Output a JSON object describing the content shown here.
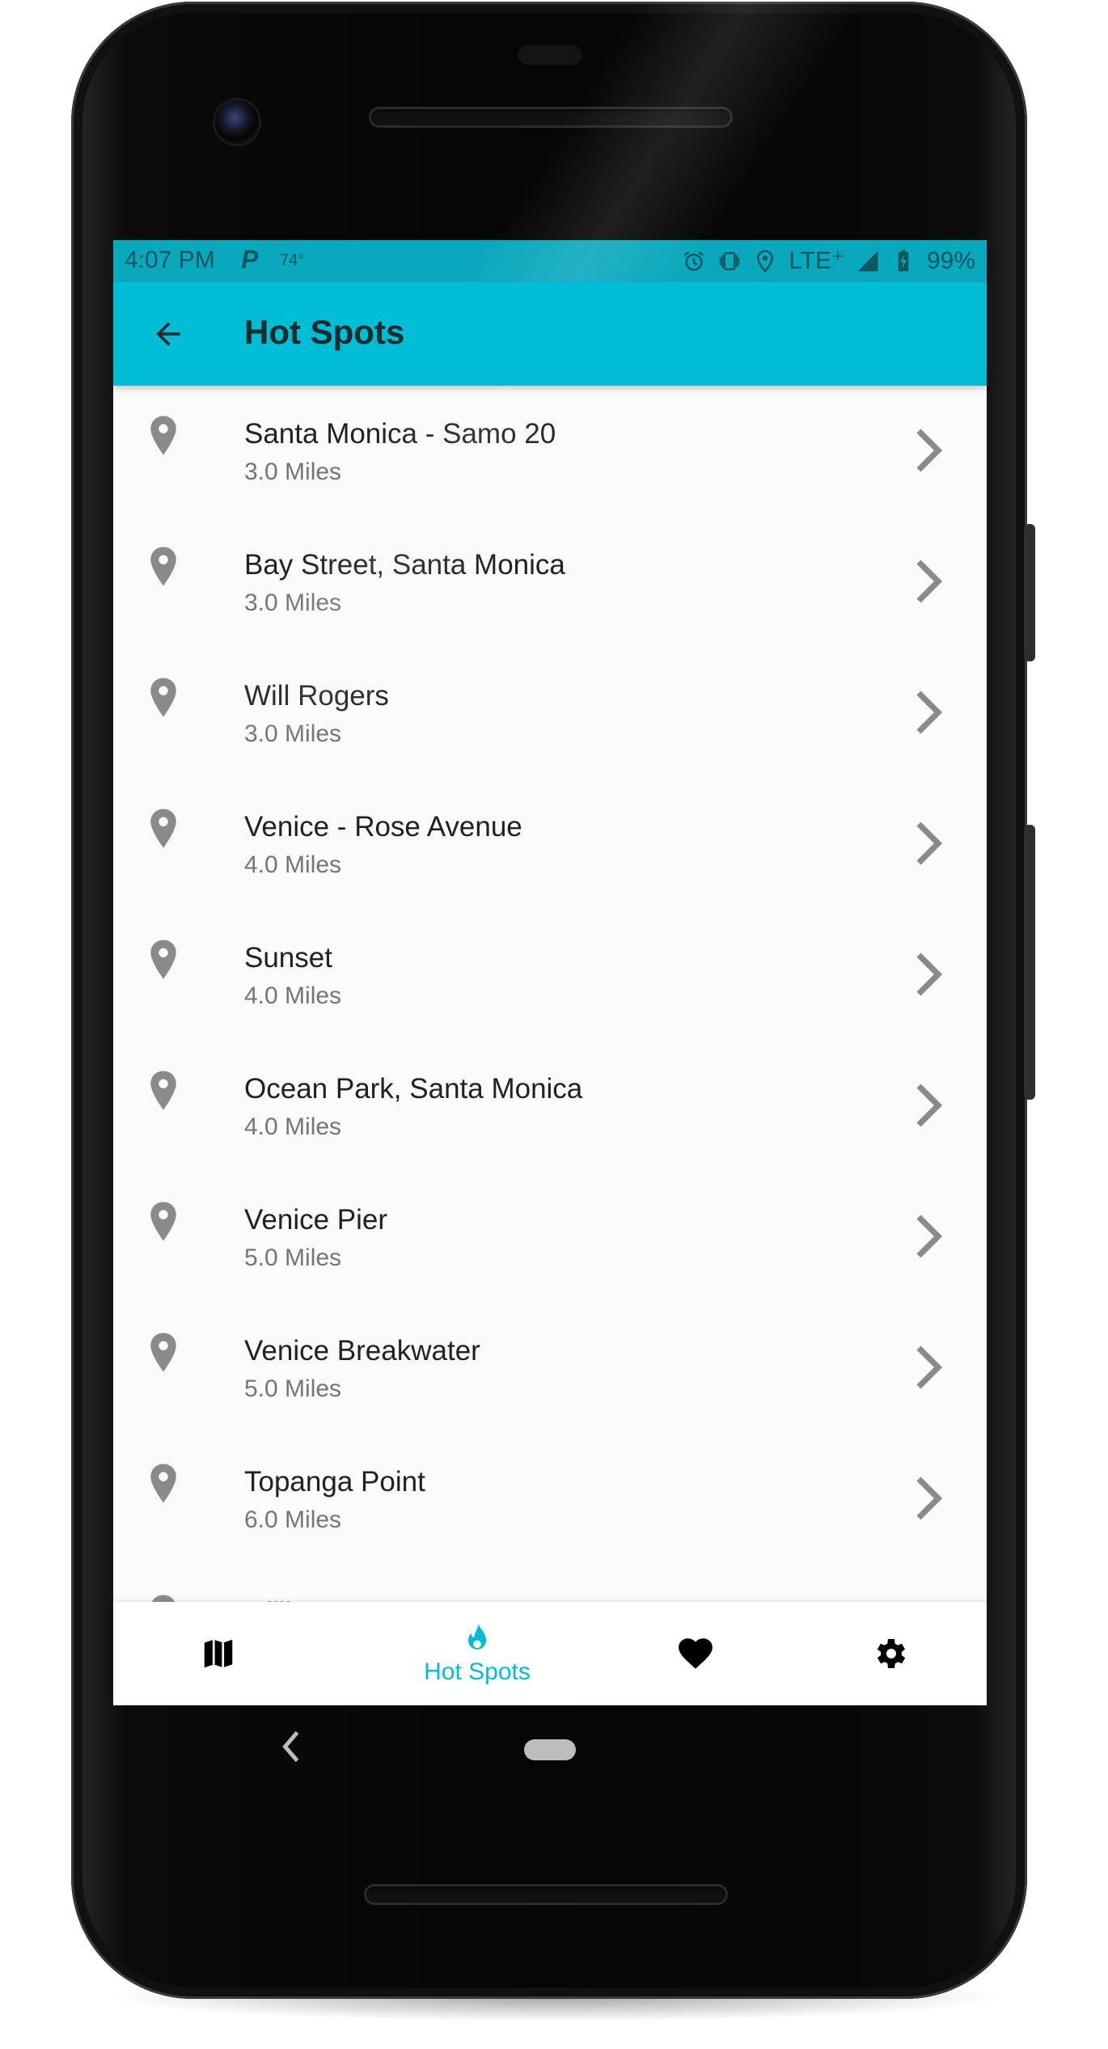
{
  "status_bar": {
    "time": "4:07 PM",
    "parking_icon_label": "P",
    "temperature": "74°",
    "network": "LTE⁺",
    "battery": "99%",
    "icons": [
      "alarm-icon",
      "vibrate-icon",
      "location-icon",
      "signal-icon",
      "battery-charging-icon"
    ]
  },
  "app_bar": {
    "title": "Hot Spots",
    "back_icon": "arrow-back-icon"
  },
  "spots": [
    {
      "name": "Santa Monica - Samo 20",
      "distance": "3.0 Miles"
    },
    {
      "name": "Bay Street, Santa Monica",
      "distance": "3.0 Miles"
    },
    {
      "name": "Will Rogers",
      "distance": "3.0 Miles"
    },
    {
      "name": "Venice - Rose Avenue",
      "distance": "4.0 Miles"
    },
    {
      "name": "Sunset",
      "distance": "4.0 Miles"
    },
    {
      "name": "Ocean Park, Santa Monica",
      "distance": "4.0 Miles"
    },
    {
      "name": "Venice Pier",
      "distance": "5.0 Miles"
    },
    {
      "name": "Venice Breakwater",
      "distance": "5.0 Miles"
    },
    {
      "name": "Topanga Point",
      "distance": "6.0 Miles"
    },
    {
      "name": "Gilli",
      "distance": ""
    }
  ],
  "bottom_nav": {
    "items": [
      {
        "icon": "map-icon",
        "label": ""
      },
      {
        "icon": "flame-icon",
        "label": "Hot Spots",
        "active": true
      },
      {
        "icon": "heart-icon",
        "label": ""
      },
      {
        "icon": "gear-icon",
        "label": ""
      }
    ]
  },
  "colors": {
    "accent": "#00bcd4",
    "status_bar": "#0aa8bd",
    "list_bg": "#fafafa",
    "icon_gray": "#8a8a8a"
  }
}
